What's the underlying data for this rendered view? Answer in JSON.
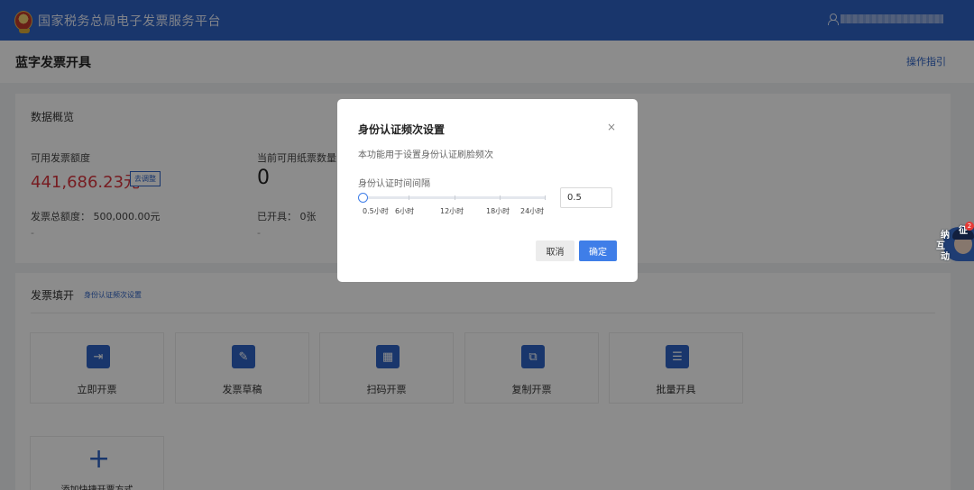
{
  "header": {
    "site_title": "国家税务总局电子发票服务平台",
    "logo_icon": "tax-emblem-icon",
    "user_icon": "user-icon"
  },
  "title_bar": {
    "page_title": "蓝字发票开具",
    "guide_link": "操作指引"
  },
  "overview": {
    "section_title": "数据概览",
    "available_quota_label": "可用发票额度",
    "available_quota_value": "441,686.23元",
    "adjust_button": "去调整",
    "total_quota_label": "发票总额度：",
    "total_quota_value": "500,000.00元",
    "dash_left": "-",
    "paper_count_label": "当前可用纸票数量（",
    "paper_count_value": "0",
    "issued_label": "已开具：",
    "issued_value": "0张",
    "dash_right": "-"
  },
  "invoice_fill": {
    "section_title": "发票填开",
    "frequency_link": "身份认证频次设置",
    "tiles": [
      {
        "label": "立即开票",
        "icon": "issue-invoice-icon",
        "glyph": "⇥"
      },
      {
        "label": "发票草稿",
        "icon": "draft-icon",
        "glyph": "✎"
      },
      {
        "label": "扫码开票",
        "icon": "qr-code-icon",
        "glyph": "▦"
      },
      {
        "label": "复制开票",
        "icon": "copy-invoice-icon",
        "glyph": "⧉"
      },
      {
        "label": "批量开具",
        "icon": "batch-issue-icon",
        "glyph": "☰"
      }
    ],
    "add_label": "添加快捷开票方式"
  },
  "assistant": {
    "chars": [
      "征",
      "纳",
      "互",
      "动"
    ],
    "badge": "2",
    "icon": "assistant-avatar-icon"
  },
  "modal": {
    "title": "身份认证频次设置",
    "close": "×",
    "description": "本功能用于设置身份认证刷脸频次",
    "slider_label": "身份认证时间间隔",
    "slider_ticks": [
      "0.5小时",
      "6小时",
      "12小时",
      "18小时",
      "24小时"
    ],
    "slider_value_hours": 0.5,
    "input_value": "0.5",
    "cancel_label": "取消",
    "confirm_label": "确定"
  },
  "colors": {
    "brand_blue": "#2f63c5",
    "primary_button": "#3f7ee8",
    "quota_red": "#d9363e"
  }
}
